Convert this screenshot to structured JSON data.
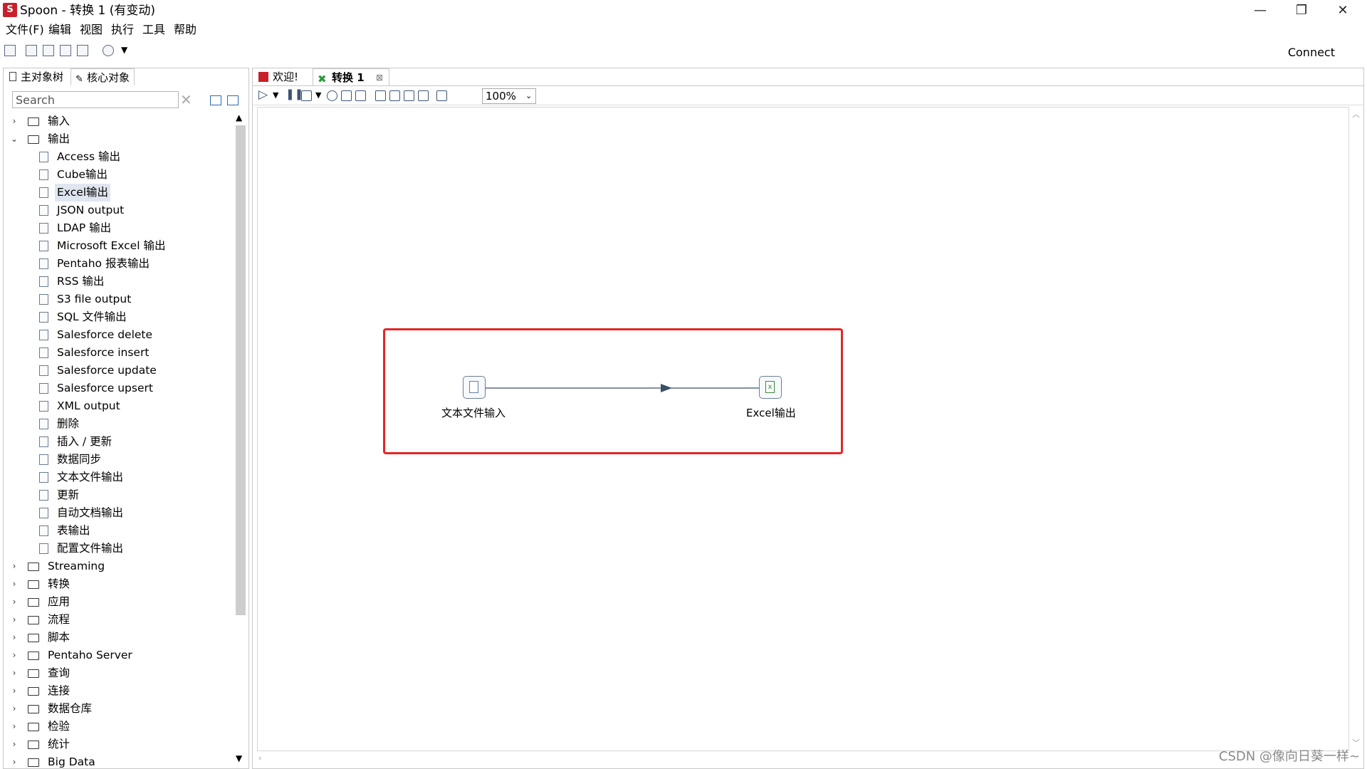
{
  "window": {
    "title": "Spoon - 转换 1 (有变动)",
    "app_icon_glyph": "S",
    "controls": {
      "minimize": "—",
      "maximize": "❐",
      "close": "✕"
    }
  },
  "menu": [
    "文件(F)",
    "编辑",
    "视图",
    "执行",
    "工具",
    "帮助"
  ],
  "toolbar": {
    "connect_label": "Connect"
  },
  "left_panel": {
    "tabs": [
      "主对象树",
      "核心对象"
    ],
    "search_placeholder": "Search",
    "tree": [
      {
        "label": "输入",
        "type": "folder",
        "expanded": false
      },
      {
        "label": "输出",
        "type": "folder",
        "expanded": true
      },
      {
        "label": "Access 输出",
        "type": "leaf"
      },
      {
        "label": "Cube输出",
        "type": "leaf"
      },
      {
        "label": "Excel输出",
        "type": "leaf",
        "selected": true
      },
      {
        "label": "JSON output",
        "type": "leaf"
      },
      {
        "label": "LDAP 输出",
        "type": "leaf"
      },
      {
        "label": "Microsoft Excel 输出",
        "type": "leaf"
      },
      {
        "label": "Pentaho 报表输出",
        "type": "leaf"
      },
      {
        "label": "RSS 输出",
        "type": "leaf"
      },
      {
        "label": "S3 file output",
        "type": "leaf"
      },
      {
        "label": "SQL 文件输出",
        "type": "leaf"
      },
      {
        "label": "Salesforce delete",
        "type": "leaf"
      },
      {
        "label": "Salesforce insert",
        "type": "leaf"
      },
      {
        "label": "Salesforce update",
        "type": "leaf"
      },
      {
        "label": "Salesforce upsert",
        "type": "leaf"
      },
      {
        "label": "XML output",
        "type": "leaf"
      },
      {
        "label": "删除",
        "type": "leaf"
      },
      {
        "label": "插入 / 更新",
        "type": "leaf"
      },
      {
        "label": "数据同步",
        "type": "leaf"
      },
      {
        "label": "文本文件输出",
        "type": "leaf"
      },
      {
        "label": "更新",
        "type": "leaf"
      },
      {
        "label": "自动文档输出",
        "type": "leaf"
      },
      {
        "label": "表输出",
        "type": "leaf"
      },
      {
        "label": "配置文件输出",
        "type": "leaf"
      },
      {
        "label": "Streaming",
        "type": "folder",
        "expanded": false
      },
      {
        "label": "转换",
        "type": "folder",
        "expanded": false
      },
      {
        "label": "应用",
        "type": "folder",
        "expanded": false
      },
      {
        "label": "流程",
        "type": "folder",
        "expanded": false
      },
      {
        "label": "脚本",
        "type": "folder",
        "expanded": false
      },
      {
        "label": "Pentaho Server",
        "type": "folder",
        "expanded": false
      },
      {
        "label": "查询",
        "type": "folder",
        "expanded": false
      },
      {
        "label": "连接",
        "type": "folder",
        "expanded": false
      },
      {
        "label": "数据仓库",
        "type": "folder",
        "expanded": false
      },
      {
        "label": "检验",
        "type": "folder",
        "expanded": false
      },
      {
        "label": "统计",
        "type": "folder",
        "expanded": false
      },
      {
        "label": "Big Data",
        "type": "folder",
        "expanded": false
      }
    ]
  },
  "editor": {
    "tabs": [
      {
        "label": "欢迎!",
        "active": false
      },
      {
        "label": "转换 1",
        "active": true,
        "closable": true
      }
    ],
    "zoom": "100%",
    "steps": [
      {
        "label": "文本文件输入",
        "icon": "text-file-input-icon"
      },
      {
        "label": "Excel输出",
        "icon": "excel-output-icon"
      }
    ]
  },
  "watermark": "CSDN @像向日葵一样~",
  "colors": {
    "highlight": "#e32626",
    "hop": "#3a5068"
  }
}
